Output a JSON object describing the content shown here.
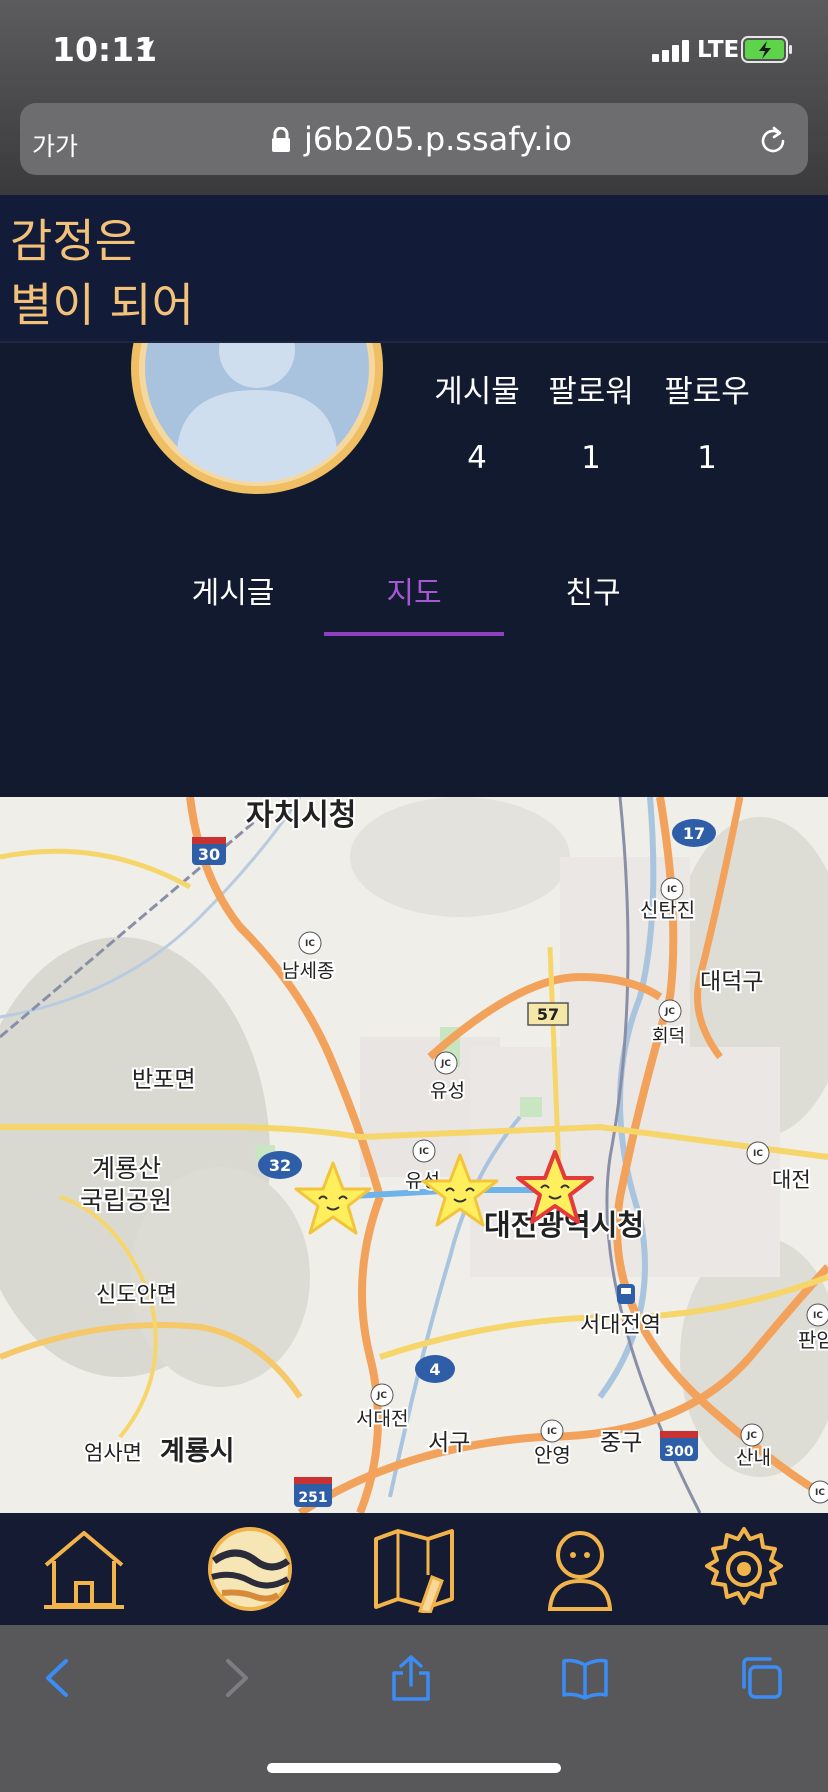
{
  "status_bar": {
    "time": "10:11",
    "network": "LTE"
  },
  "browser": {
    "text_size_button": "가가",
    "url": "j6b205.p.ssafy.io"
  },
  "app": {
    "title_line1": "감정은",
    "title_line2": "별이 되어"
  },
  "profile": {
    "stats": [
      {
        "label": "게시물",
        "value": "4"
      },
      {
        "label": "팔로워",
        "value": "1"
      },
      {
        "label": "팔로우",
        "value": "1"
      }
    ]
  },
  "tabs": [
    {
      "label": "게시글",
      "active": false
    },
    {
      "label": "지도",
      "active": true
    },
    {
      "label": "친구",
      "active": false
    }
  ],
  "map": {
    "labels": {
      "sejong_hall": "자치시청",
      "sintanjin": "신탄진",
      "daedeokgu": "대덕구",
      "hoedeok": "회덕",
      "namsejong": "남세종",
      "yuseong": "유성",
      "banpo": "반포면",
      "gyeryongsan1": "계룡산",
      "gyeryongsan2": "국립공원",
      "yuseong2": "유성",
      "daejeon_hall": "대전광역시청",
      "daejeon_right": "대전",
      "sindoan": "신도안면",
      "seodaejeon_station": "서대전역",
      "panam": "판암",
      "seodaejeon": "서대전",
      "seogu": "서구",
      "anyeong": "안영",
      "junggu": "중구",
      "sannae": "산내",
      "eomsa": "엄사면",
      "gyeryongsi": "계룡시"
    },
    "shields": {
      "r30": "30",
      "r17": "17",
      "r57": "57",
      "r32": "32",
      "r4": "4",
      "r300": "300",
      "r251": "251"
    },
    "junction_mark": "JC",
    "ic_mark": "IC"
  },
  "colors": {
    "app_bg": "#111a2f",
    "accent_gold": "#f2c27a",
    "tab_active": "#a657d3",
    "star_fill": "#ffef5c"
  },
  "bottom_nav_icons": [
    "home-icon",
    "planet-icon",
    "map-pencil-icon",
    "person-icon",
    "gear-icon"
  ],
  "safari_toolbar_icons": [
    "back-icon",
    "forward-icon",
    "share-icon",
    "bookmarks-icon",
    "tabs-icon"
  ]
}
